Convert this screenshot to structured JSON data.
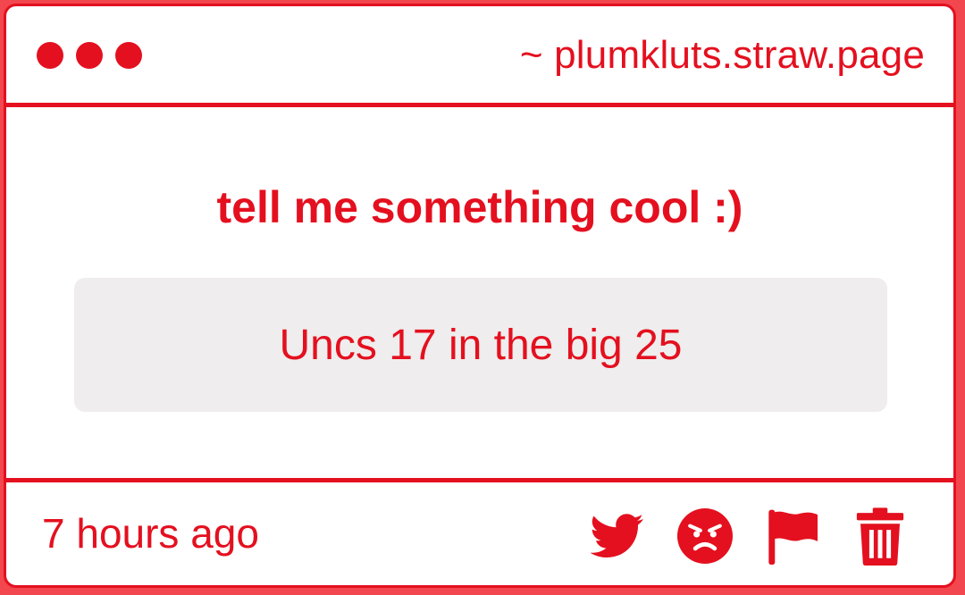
{
  "window": {
    "url": "~ plumkluts.straw.page"
  },
  "question": "tell me something cool :)",
  "answer": "Uncs 17 in the big 25",
  "footer": {
    "timestamp": "7 hours ago",
    "actions": [
      {
        "icon": "twitter-icon"
      },
      {
        "icon": "angry-face-icon"
      },
      {
        "icon": "flag-icon"
      },
      {
        "icon": "trash-icon"
      }
    ]
  },
  "colors": {
    "accent": "#e4101f",
    "answer_background": "#efeded",
    "page_background": "#f2474f"
  }
}
